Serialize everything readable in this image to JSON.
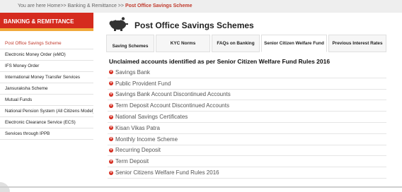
{
  "breadcrumb": {
    "prefix": "You are here ",
    "home": "Home",
    "sep1": ">> ",
    "section": "Banking & Remittance",
    "sep2": " >> ",
    "current": "Post Office Savings Scheme"
  },
  "sidebar": {
    "header": "BANKING & REMITTANCE",
    "items": [
      {
        "label": "Post Office Savings Scheme"
      },
      {
        "label": "Electronic Money Order (eMO)"
      },
      {
        "label": "IFS Money Order"
      },
      {
        "label": "International Money Transfer Services"
      },
      {
        "label": "Jansuraksha Scheme"
      },
      {
        "label": "Mutual Funds"
      },
      {
        "label": "National Pension System (All Citizens Model)"
      },
      {
        "label": "Electronic Clearance Service (ECS)"
      },
      {
        "label": "Services through IPPB"
      }
    ]
  },
  "page": {
    "title": "Post Office Savings Schemes"
  },
  "tabs": [
    {
      "label": "Saving Schemes"
    },
    {
      "label": "KYC Norms"
    },
    {
      "label": "FAQs on Banking"
    },
    {
      "label": "Senior Citizen Welfare Fund"
    },
    {
      "label": "Previous Interest Rates"
    }
  ],
  "content": {
    "heading": "Unclaimed accounts identified as per Senior Citizen Welfare Fund Rules 2016",
    "items": [
      {
        "label": "Savings Bank"
      },
      {
        "label": "Public Provident Fund"
      },
      {
        "label": "Savings Bank Account Discontinued Accounts"
      },
      {
        "label": "Term Deposit Account Discontinued Accounts"
      },
      {
        "label": "National Savings Certificates"
      },
      {
        "label": "Kisan Vikas Patra"
      },
      {
        "label": "Monthly Income Scheme"
      },
      {
        "label": "Recurring Deposit"
      },
      {
        "label": "Term Deposit"
      },
      {
        "label": "Senior Citizens Welfare Fund Rules 2016"
      }
    ]
  },
  "colors": {
    "accent": "#d52b1e",
    "underline": "#f1a93b",
    "active_text": "#c0392b"
  },
  "icons": {
    "title_icon": "piggy-bank-icon",
    "item_icon": "plus-circle-icon"
  }
}
